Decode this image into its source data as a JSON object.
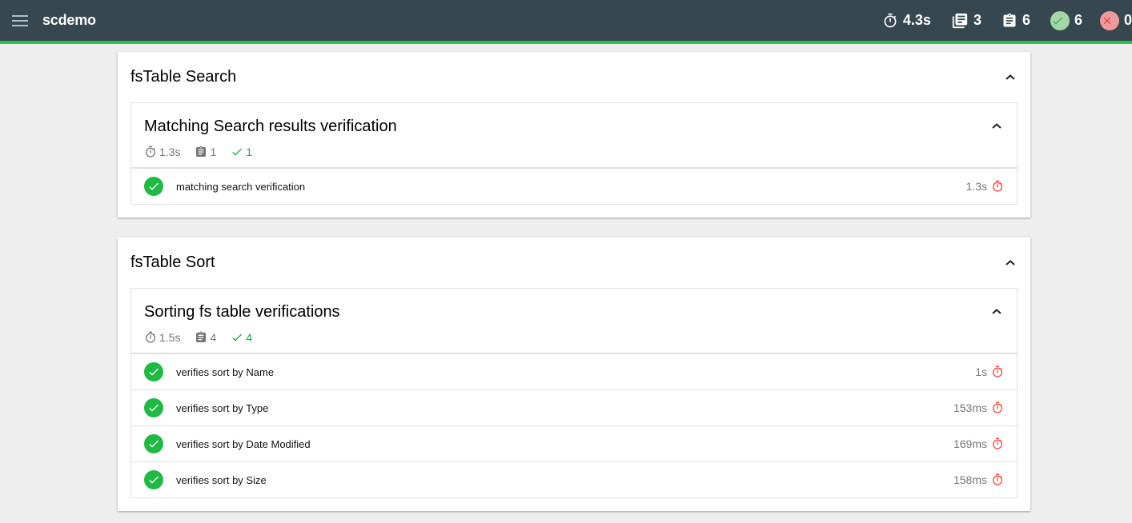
{
  "app": {
    "title": "scdemo"
  },
  "header_stats": {
    "duration": "4.3s",
    "suites": "3",
    "tests": "6",
    "passes": "6",
    "failures": "0"
  },
  "colors": {
    "topbar": "#37474f",
    "accent": "#2bc24a",
    "pass": "#1fba44",
    "slow_timer": "#f44336"
  },
  "suites": [
    {
      "title": "fsTable Search",
      "inner": {
        "title": "Matching Search results verification",
        "duration": "1.3s",
        "tests": "1",
        "passes": "1",
        "rows": [
          {
            "title": "matching search verification",
            "duration": "1.3s"
          }
        ]
      }
    },
    {
      "title": "fsTable Sort",
      "inner": {
        "title": "Sorting fs table verifications",
        "duration": "1.5s",
        "tests": "4",
        "passes": "4",
        "rows": [
          {
            "title": "verifies sort by Name",
            "duration": "1s"
          },
          {
            "title": "verifies sort by Type",
            "duration": "153ms"
          },
          {
            "title": "verifies sort by Date Modified",
            "duration": "169ms"
          },
          {
            "title": "verifies sort by Size",
            "duration": "158ms"
          }
        ]
      }
    }
  ],
  "icons": {
    "menu": "menu-icon",
    "timer": "stopwatch-icon",
    "suites": "library-books-icon",
    "tests": "clipboard-icon",
    "passes": "check-circle-icon",
    "failures": "close-circle-icon",
    "collapse": "chevron-up-icon"
  }
}
